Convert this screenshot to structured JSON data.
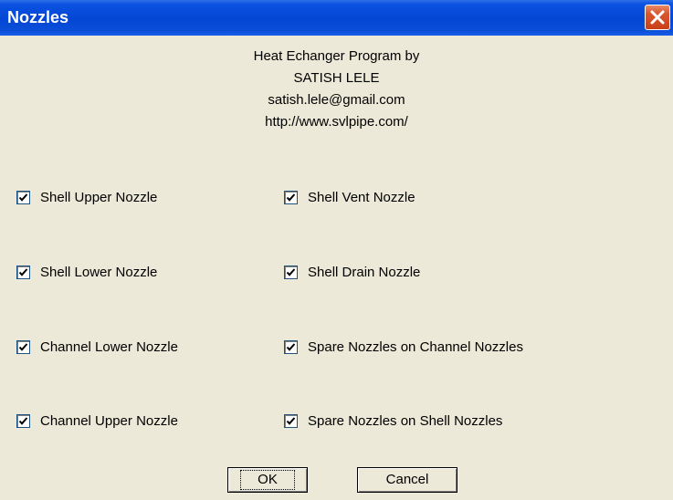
{
  "window": {
    "title": "Nozzles",
    "close_icon": "close-x-icon"
  },
  "credits": {
    "line1": "Heat Echanger Program by",
    "line2": "SATISH LELE",
    "line3": "satish.lele@gmail.com",
    "line4": "http://www.svlpipe.com/"
  },
  "checkboxes": {
    "shell_upper": {
      "label": "Shell Upper Nozzle",
      "checked": true
    },
    "shell_vent": {
      "label": "Shell Vent Nozzle",
      "checked": true
    },
    "shell_lower": {
      "label": "Shell Lower Nozzle",
      "checked": true
    },
    "shell_drain": {
      "label": "Shell Drain Nozzle",
      "checked": true
    },
    "channel_lower": {
      "label": "Channel Lower Nozzle",
      "checked": true
    },
    "spare_channel": {
      "label": "Spare Nozzles on Channel Nozzles",
      "checked": true
    },
    "channel_upper": {
      "label": "Channel Upper Nozzle",
      "checked": true
    },
    "spare_shell": {
      "label": "Spare Nozzles on Shell Nozzles",
      "checked": true
    }
  },
  "buttons": {
    "ok": "OK",
    "cancel": "Cancel"
  },
  "colors": {
    "titlebar": "#0446d4",
    "dialog_background": "#ece9d8",
    "close_button": "#c8401a"
  }
}
